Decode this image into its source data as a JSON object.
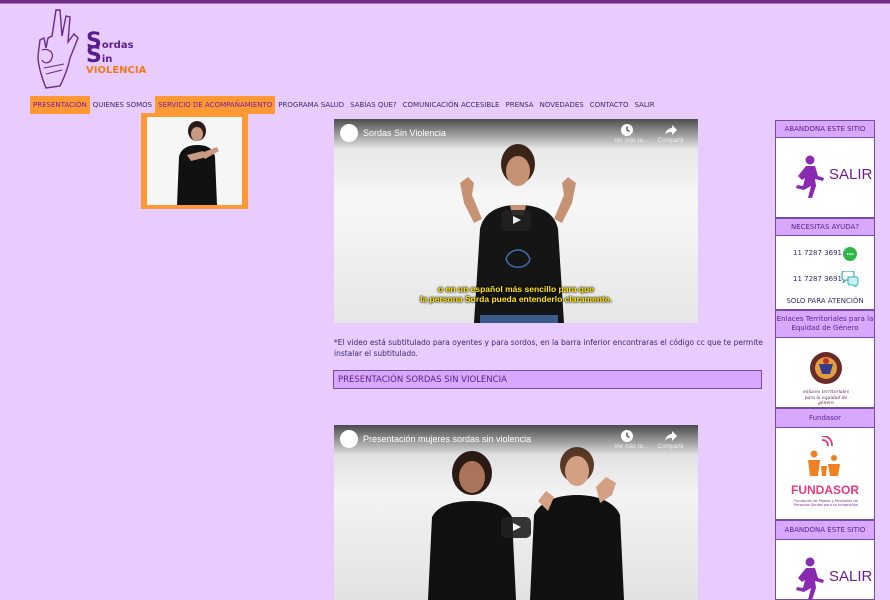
{
  "logo": {
    "word1_initial": "S",
    "word1_rest": "ordas",
    "word2_initial": "S",
    "word2_rest": "in",
    "word3": "VIOLENCIA"
  },
  "nav": {
    "items": [
      {
        "label": "PRESENTACIÓN",
        "state": "active"
      },
      {
        "label": "QUIENES SOMOS",
        "state": "normal"
      },
      {
        "label": "SERVICIO DE ACOMPAÑAMIENTO",
        "state": "highlight"
      },
      {
        "label": "PROGRAMA SALUD",
        "state": "normal"
      },
      {
        "label": "SABÍAS QUE?",
        "state": "normal"
      },
      {
        "label": "COMUNICACIÓN ACCESIBLE",
        "state": "normal"
      },
      {
        "label": "PRENSA",
        "state": "normal"
      },
      {
        "label": "NOVEDADES",
        "state": "normal"
      },
      {
        "label": "CONTACTO",
        "state": "normal"
      },
      {
        "label": "SALIR",
        "state": "normal"
      }
    ]
  },
  "video1": {
    "title": "Sordas Sin Violencia",
    "watch_later": "Ver más ta...",
    "share": "Compartir",
    "caption_line1": "o en un español más sencillo para que",
    "caption_line2": "la persona Sorda pueda entenderlo claramente."
  },
  "note": "*El video está subtitulado para oyentes y para sordos, en la barra inferior encontraras el código cc que te permite instalar el subtitulado.",
  "section_title": "PRESENTACIÓN SORDAS SIN VIOLENCIA",
  "video2": {
    "title": "Presentación mujeres sordas sin violencia",
    "watch_later": "Ver más ta...",
    "share": "Compartir"
  },
  "sidebar": {
    "abandona": "ABANDONA ESTE SITIO",
    "salir": "SALIR",
    "ayuda": "NECESITAS AYUDA?",
    "phone1": "11 7287 3691",
    "phone2": "11 7287 3691",
    "solo": "SOLO PARA ATENCIÓN",
    "enlaces": "Enlaces Territoriales para la Equidad de Género",
    "enlaces_logo_line1": "enlaces territoriales",
    "enlaces_logo_line2": "para la equidad de género",
    "fundasor_head": "Fundasor",
    "fundasor_word": "FUNDASOR",
    "fundasor_sub": "Fundación de Padres y Familiares de Personas Sordas para su Integración",
    "abandona2": "ABANDONA ESTE SITIO",
    "salir2": "SALIR"
  },
  "colors": {
    "background": "#e8ccff",
    "accent_orange": "#ff9933",
    "accent_purple": "#5a1e8c",
    "section_bar": "#d8a8ff"
  }
}
